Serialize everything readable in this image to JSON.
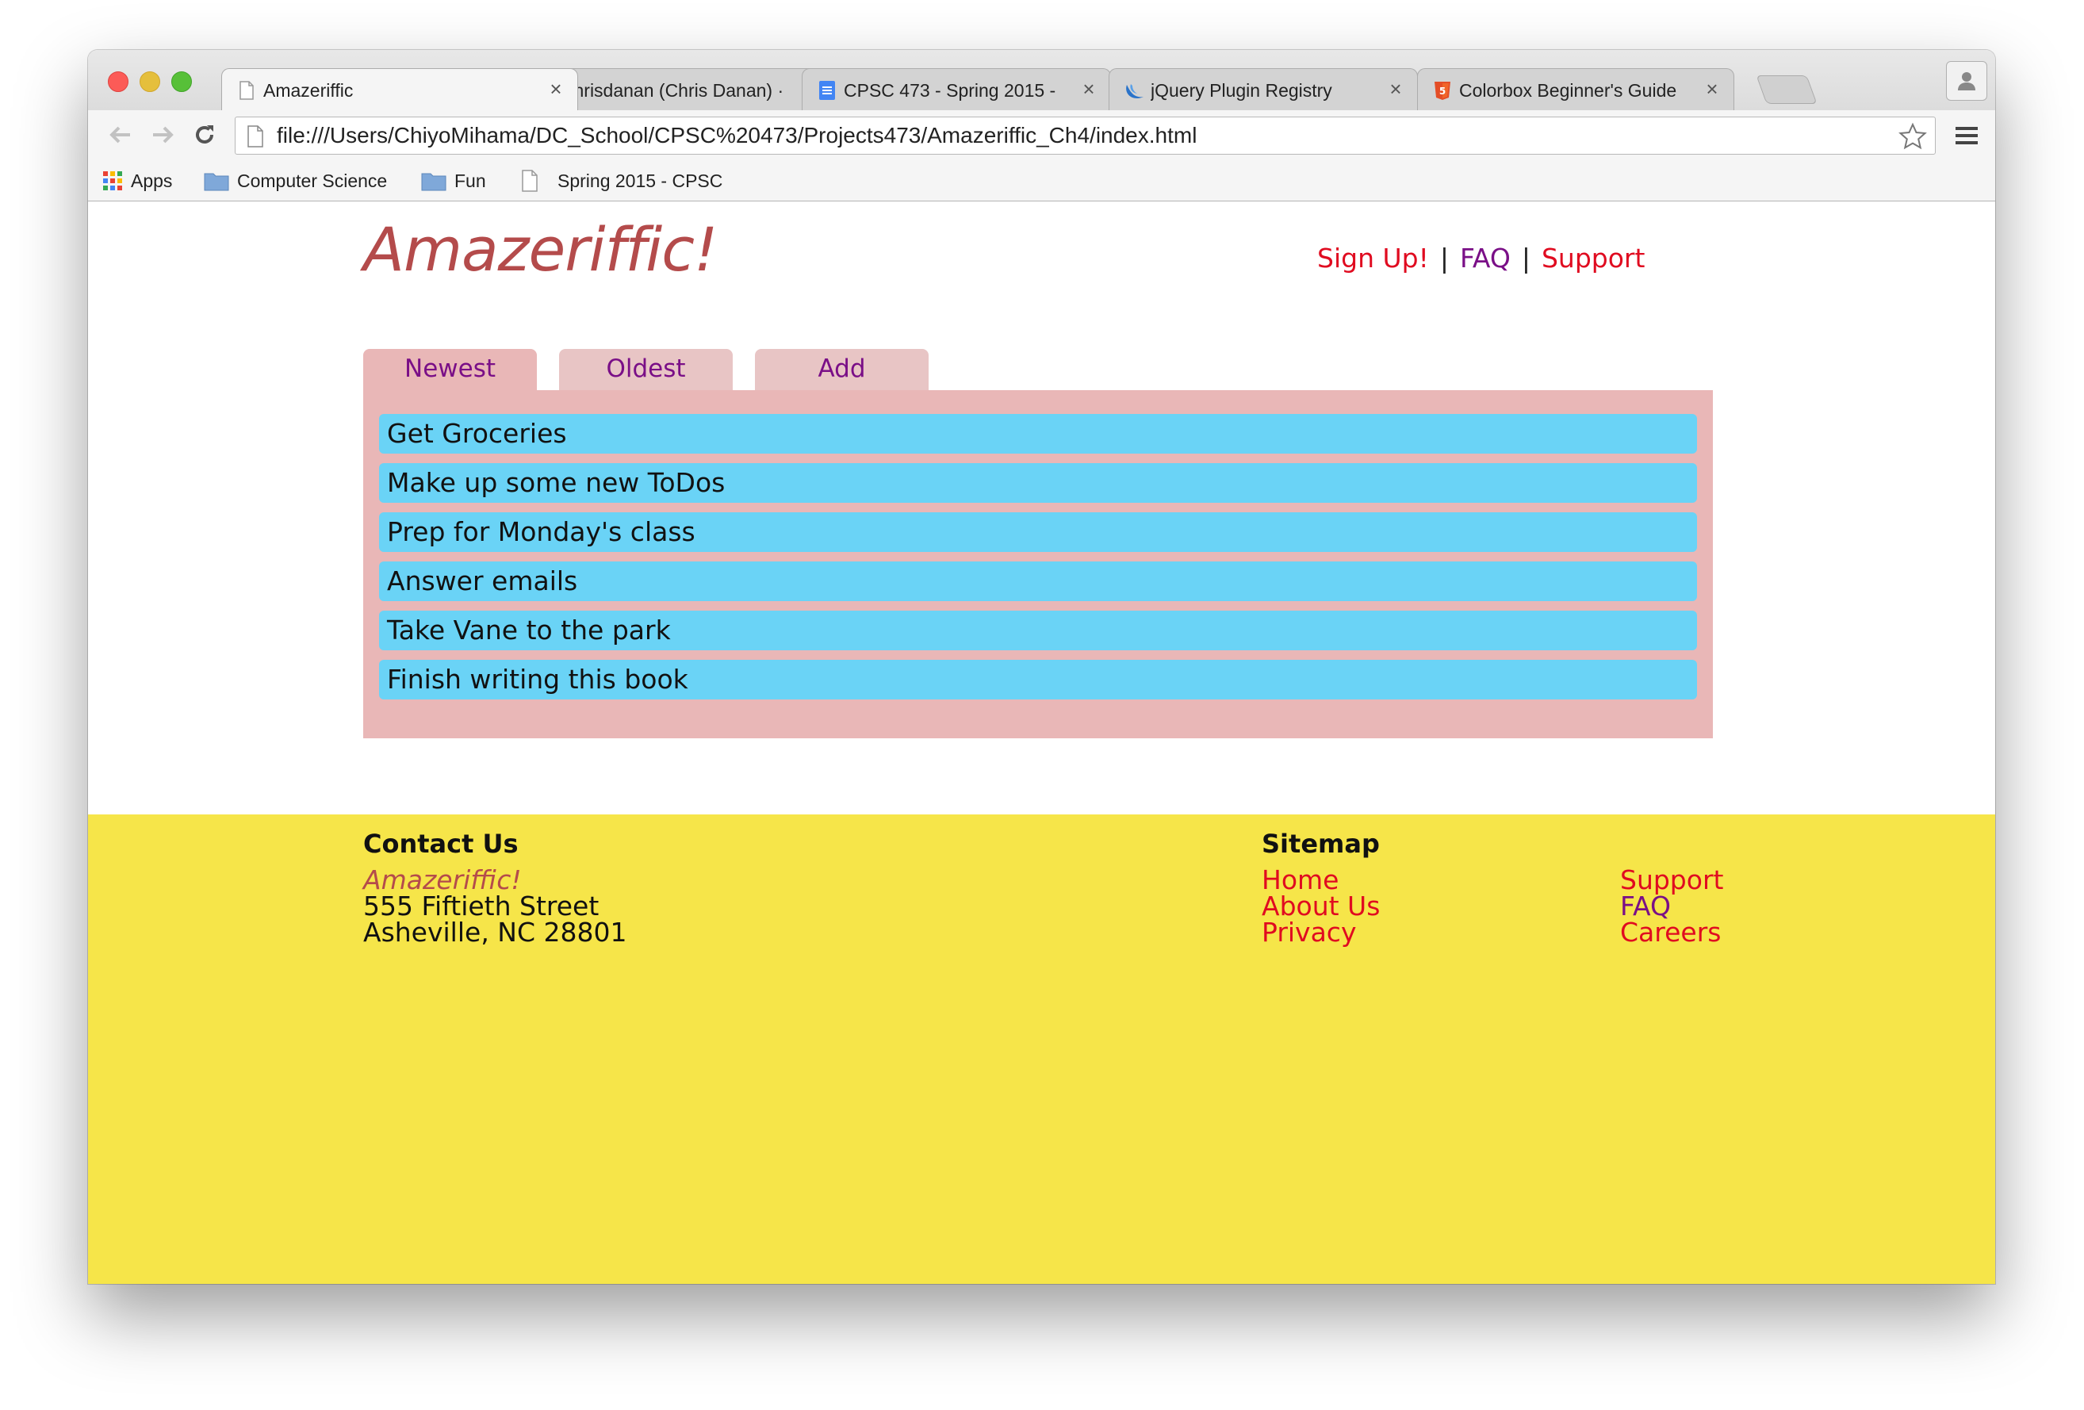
{
  "browser": {
    "tabs": [
      {
        "title": "Amazeriffic",
        "icon": "page-icon",
        "active": true
      },
      {
        "title": "chrisdanan (Chris Danan) ·",
        "icon": "github-icon",
        "active": false
      },
      {
        "title": "CPSC 473 - Spring 2015 -",
        "icon": "google-docs-icon",
        "active": false
      },
      {
        "title": "jQuery Plugin Registry",
        "icon": "jquery-icon",
        "active": false
      },
      {
        "title": "Colorbox Beginner's Guide",
        "icon": "html5-icon",
        "active": false
      }
    ],
    "tab_close_glyph": "×",
    "url": "file:///Users/ChiyoMihama/DC_School/CPSC%20473/Projects473/Amazeriffic_Ch4/index.html",
    "bookmarks": [
      {
        "label": "Apps",
        "icon": "apps-grid-icon"
      },
      {
        "label": "Computer Science",
        "icon": "folder-icon"
      },
      {
        "label": "Fun",
        "icon": "folder-icon"
      },
      {
        "label": "Spring 2015 - CPSC",
        "icon": "page-icon"
      }
    ]
  },
  "site": {
    "logo": "Amazeriffic!",
    "nav": {
      "signup": "Sign Up!",
      "faq": "FAQ",
      "support": "Support",
      "separator": "|"
    },
    "tabs": [
      {
        "label": "Newest",
        "active": true
      },
      {
        "label": "Oldest",
        "active": false
      },
      {
        "label": "Add",
        "active": false
      }
    ],
    "todos": [
      "Get Groceries",
      "Make up some new ToDos",
      "Prep for Monday's class",
      "Answer emails",
      "Take Vane to the park",
      "Finish writing this book"
    ],
    "footer": {
      "contact_heading": "Contact Us",
      "company": "Amazeriffic!",
      "street": "555 Fiftieth Street",
      "city": "Asheville, NC 28801",
      "sitemap_heading": "Sitemap",
      "sitemap_col1": [
        "Home",
        "About Us",
        "Privacy"
      ],
      "sitemap_col2": [
        "Support",
        "FAQ",
        "Careers"
      ]
    }
  },
  "colors": {
    "logo": "#b44b4b",
    "link": "#e00b20",
    "visited_link": "#7a0f87",
    "tab_panel": "#e9b7b7",
    "todo_item": "#6ad3f6",
    "footer": "#f6e549"
  }
}
